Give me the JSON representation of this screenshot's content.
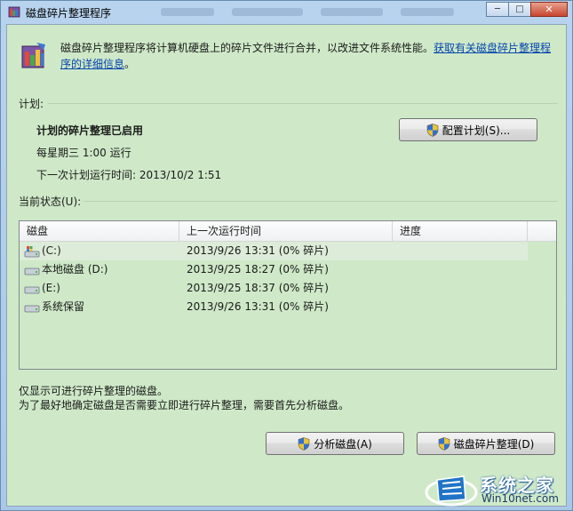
{
  "window": {
    "title": "磁盘碎片整理程序",
    "controls": {
      "minimize": "─",
      "maximize": "□",
      "close": "✕"
    }
  },
  "description": {
    "text": "磁盘碎片整理程序将计算机硬盘上的碎片文件进行合并，以改进文件系统性能。",
    "link": "获取有关磁盘碎片整理程序的详细信息",
    "period": "。"
  },
  "schedule": {
    "section_label": "计划:",
    "status": "计划的碎片整理已启用",
    "frequency": "每星期三  1:00 运行",
    "next_run": "下一次计划运行时间: 2013/10/2 1:51",
    "configure_button": "配置计划(S)..."
  },
  "current_status": {
    "section_label": "当前状态(U):",
    "columns": [
      "磁盘",
      "上一次运行时间",
      "进度"
    ],
    "disks": [
      {
        "name": "(C:)",
        "last_run": "2013/9/26 13:31 (0% 碎片)",
        "progress": "",
        "icon": "system-drive-icon"
      },
      {
        "name": "本地磁盘 (D:)",
        "last_run": "2013/9/25 18:27 (0% 碎片)",
        "progress": "",
        "icon": "drive-icon"
      },
      {
        "name": "(E:)",
        "last_run": "2013/9/25 18:37 (0% 碎片)",
        "progress": "",
        "icon": "drive-icon"
      },
      {
        "name": "系统保留",
        "last_run": "2013/9/26 13:31 (0% 碎片)",
        "progress": "",
        "icon": "drive-icon"
      }
    ]
  },
  "footer": {
    "note1": "仅显示可进行碎片整理的磁盘。",
    "note2": "为了最好地确定磁盘是否需要立即进行碎片整理，需要首先分析磁盘。",
    "analyze_button": "分析磁盘(A)",
    "defrag_button": "磁盘碎片整理(D)"
  },
  "watermark": {
    "brand": "系统之家",
    "url": "Win10net.com"
  },
  "colors": {
    "client_bg": "#cfe9c8",
    "link": "#0645ad",
    "title_bg": "#b8d3ee"
  }
}
